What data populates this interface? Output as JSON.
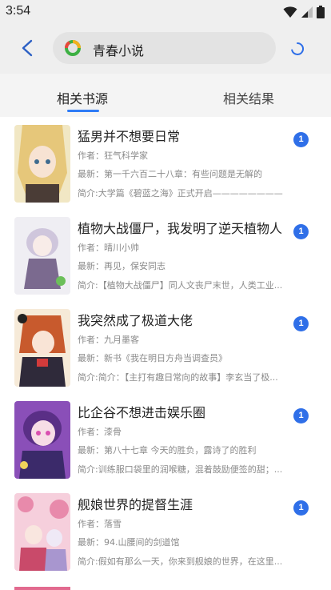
{
  "status_bar": {
    "time": "3:54"
  },
  "search": {
    "query": "青春小说"
  },
  "tabs": [
    {
      "label": "相关书源"
    },
    {
      "label": "相关结果"
    }
  ],
  "books": [
    {
      "title": "猛男并不想要日常",
      "author": "作者：狂气科学家",
      "latest": "最新：第一千六百二十八章：有些问题是无解的",
      "intro": "简介:大学篇《碧蓝之海》正式开启————————",
      "count": "1",
      "cover_colors": [
        "#e9d9a2",
        "#caa15a",
        "#5a4a3e"
      ]
    },
    {
      "title": "植物大战僵尸，我发明了逆天植物人",
      "author": "作者：晴川小帅",
      "latest": "最新：再见，保安同志",
      "intro": "简介:【植物大战僵尸】同人文丧尸末世，人类工业...",
      "count": "1",
      "cover_colors": [
        "#e9e4ef",
        "#b7a9cc",
        "#7d6a93"
      ]
    },
    {
      "title": "我突然成了极道大佬",
      "author": "作者：九月墨客",
      "latest": "最新：新书《我在明日方舟当调查员》",
      "intro": "简介:简介：【主打有趣日常向的故事】李玄当了极...",
      "count": "1",
      "cover_colors": [
        "#f4e1c8",
        "#c9582f",
        "#2f2a3a"
      ]
    },
    {
      "title": "比企谷不想进击娱乐圈",
      "author": "作者：漆骨",
      "latest": "最新：第八十七章 今天的胜负，露诗了的胜利",
      "intro": "简介:训练服口袋里的润喉糖，混着鼓励便签的甜；...",
      "count": "1",
      "cover_colors": [
        "#8a4fb8",
        "#d96db5",
        "#3b2a6a"
      ]
    },
    {
      "title": "舰娘世界的提督生涯",
      "author": "作者：落雪",
      "latest": "最新：94.山腰间的剑道馆",
      "intro": "简介:假如有那么一天，你来到舰娘的世界，在这里...",
      "count": "1",
      "cover_colors": [
        "#f6c7d6",
        "#e07aa0",
        "#b9a3d6"
      ]
    }
  ]
}
